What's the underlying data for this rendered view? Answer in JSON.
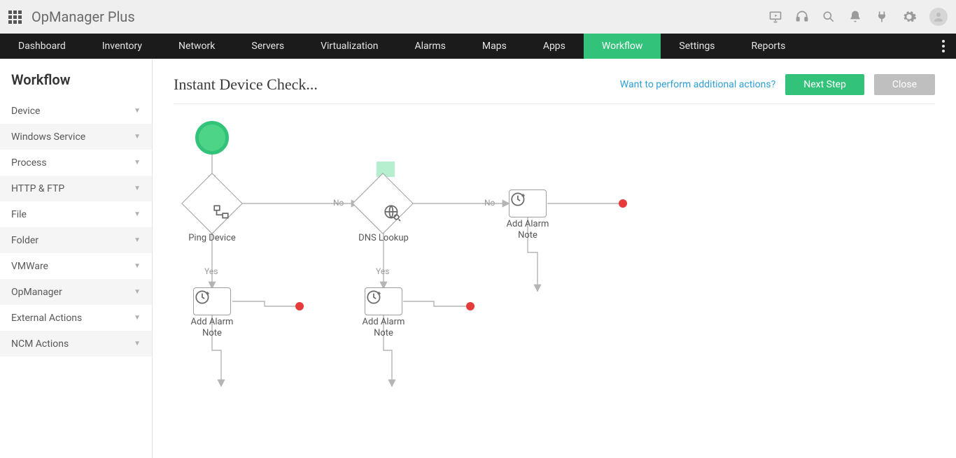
{
  "app": {
    "title": "OpManager Plus"
  },
  "nav": {
    "items": [
      "Dashboard",
      "Inventory",
      "Network",
      "Servers",
      "Virtualization",
      "Alarms",
      "Maps",
      "Apps",
      "Workflow",
      "Settings",
      "Reports"
    ],
    "active": "Workflow"
  },
  "sidebar": {
    "title": "Workflow",
    "categories": [
      "Device",
      "Windows Service",
      "Process",
      "HTTP & FTP",
      "File",
      "Folder",
      "VMWare",
      "OpManager",
      "External Actions",
      "NCM Actions"
    ]
  },
  "page": {
    "title": "Instant Device Check...",
    "additional_link": "Want to perform additional actions?",
    "next_btn": "Next Step",
    "close_btn": "Close"
  },
  "flow": {
    "ping_label": "Ping Device",
    "dns_label": "DNS Lookup",
    "note_label": "Add Alarm Note",
    "yes": "Yes",
    "no": "No"
  }
}
